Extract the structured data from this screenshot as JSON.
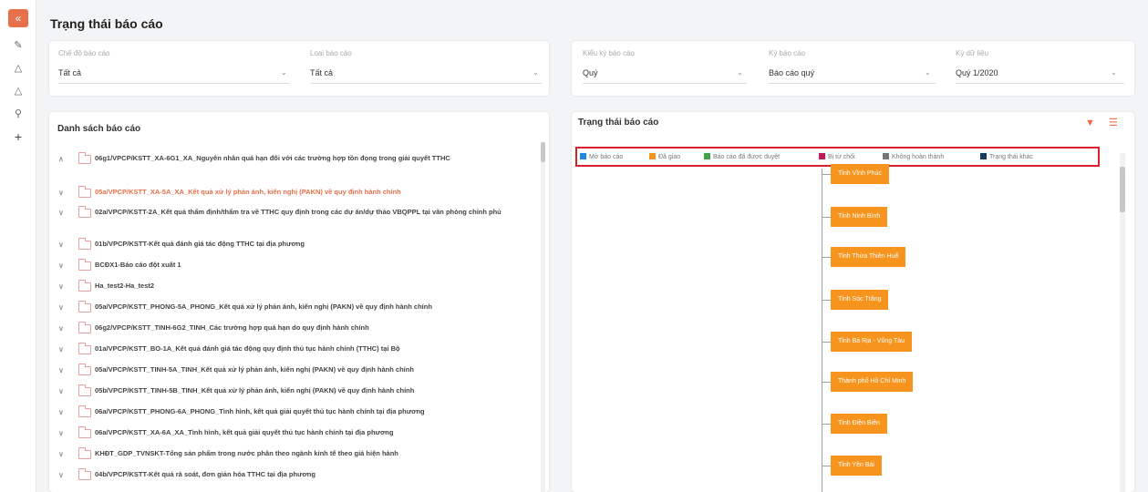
{
  "page": {
    "title": "Trạng thái báo cáo"
  },
  "sidebar": {
    "toggle_icon": "collapse-icon",
    "icons": [
      "edit-icon",
      "chart-icon",
      "chart-icon",
      "search-icon",
      "plus-icon"
    ]
  },
  "filters_left": [
    {
      "label": "Chế độ báo cáo",
      "value": "Tất cả"
    },
    {
      "label": "Loại báo cáo",
      "value": "Tất cả"
    }
  ],
  "filters_right": [
    {
      "label": "Kiểu kỳ báo cáo",
      "value": "Quý"
    },
    {
      "label": "Kỳ báo cáo",
      "value": "Báo cáo quý"
    },
    {
      "label": "Kỳ dữ liệu",
      "value": "Quý 1/2020"
    }
  ],
  "report_list": {
    "title": "Danh sách báo cáo",
    "items": [
      {
        "text": "06g1/VPCP/KSTT_XA-6G1_XA_Nguyên nhân quá hạn đối với các trường hợp tồn đọng trong giải quyết TTHC",
        "expanded": true,
        "active": false
      },
      {
        "text": "05a/VPCP/KSTT_XA-5A_XA_Kết quả xử lý phản ánh, kiến nghị (PAKN) về quy định hành chính",
        "expanded": false,
        "active": true
      },
      {
        "text": "02a/VPCP/KSTT-2A_Kết quả thẩm định/thẩm tra về TTHC quy định trong các dự án/dự thảo VBQPPL tại văn phòng chính phủ",
        "expanded": false,
        "active": false
      },
      {
        "text": "01b/VPCP/KSTT-Kết quả đánh giá tác động TTHC tại địa phương",
        "expanded": false,
        "active": false
      },
      {
        "text": "BCĐX1-Báo cáo đột xuất 1",
        "expanded": false,
        "active": false
      },
      {
        "text": "Ha_test2-Ha_test2",
        "expanded": false,
        "active": false
      },
      {
        "text": "05a/VPCP/KSTT_PHONG-5A_PHONG_Kết quả xử lý phản ánh, kiến nghị (PAKN) về quy định hành chính",
        "expanded": false,
        "active": false
      },
      {
        "text": "06g2/VPCP/KSTT_TINH-6G2_TINH_Các trường hợp quá hạn do quy định hành chính",
        "expanded": false,
        "active": false
      },
      {
        "text": "01a/VPCP/KSTT_BO-1A_Kết quả đánh giá tác động quy định thủ tục hành chính (TTHC) tại Bộ",
        "expanded": false,
        "active": false
      },
      {
        "text": "05a/VPCP/KSTT_TINH-5A_TINH_Kết quả xử lý phản ánh, kiến nghị (PAKN) về quy định hành chính",
        "expanded": false,
        "active": false
      },
      {
        "text": "05b/VPCP/KSTT_TINH-5B_TINH_Kết quả xử lý phản ánh, kiến nghị (PAKN) về quy định hành chính",
        "expanded": false,
        "active": false
      },
      {
        "text": "06a/VPCP/KSTT_PHONG-6A_PHONG_Tình hình, kết quả giải quyết thủ tục hành chính tại địa phương",
        "expanded": false,
        "active": false
      },
      {
        "text": "06a/VPCP/KSTT_XA-6A_XA_Tình hình, kết quả giải quyết thủ tục hành chính tại địa phương",
        "expanded": false,
        "active": false
      },
      {
        "text": "KHĐT_GDP_TVNSKT-Tổng sản phẩm trong nước phân theo ngành kinh tế theo giá hiện hành",
        "expanded": false,
        "active": false
      },
      {
        "text": "04b/VPCP/KSTT-Kết quả rà soát, đơn giản hóa TTHC tại địa phương",
        "expanded": false,
        "active": false
      }
    ]
  },
  "status_panel": {
    "title": "Trạng thái báo cáo",
    "tool_icons": [
      "download-icon",
      "list-icon"
    ],
    "legend": [
      {
        "label": "Mở báo cáo",
        "color": "#1e88e5"
      },
      {
        "label": "Đã giao",
        "color": "#f7941d"
      },
      {
        "label": "Báo cáo đã được duyệt",
        "color": "#43a047"
      },
      {
        "label": "Bị từ chối",
        "color": "#c2185b"
      },
      {
        "label": "Không hoàn thành",
        "color": "#757575"
      },
      {
        "label": "Trạng thái khác",
        "color": "#1a3a5c"
      }
    ],
    "nodes": [
      "Tỉnh Vĩnh Phúc",
      "Tỉnh Ninh Bình",
      "Tỉnh Thừa Thiên Huế",
      "Tỉnh Sóc Trăng",
      "Tỉnh Bà Rịa - Vũng Tàu",
      "Thành phố Hồ Chí Minh",
      "Tỉnh Điện Biên",
      "Tỉnh Yên Bái"
    ]
  }
}
